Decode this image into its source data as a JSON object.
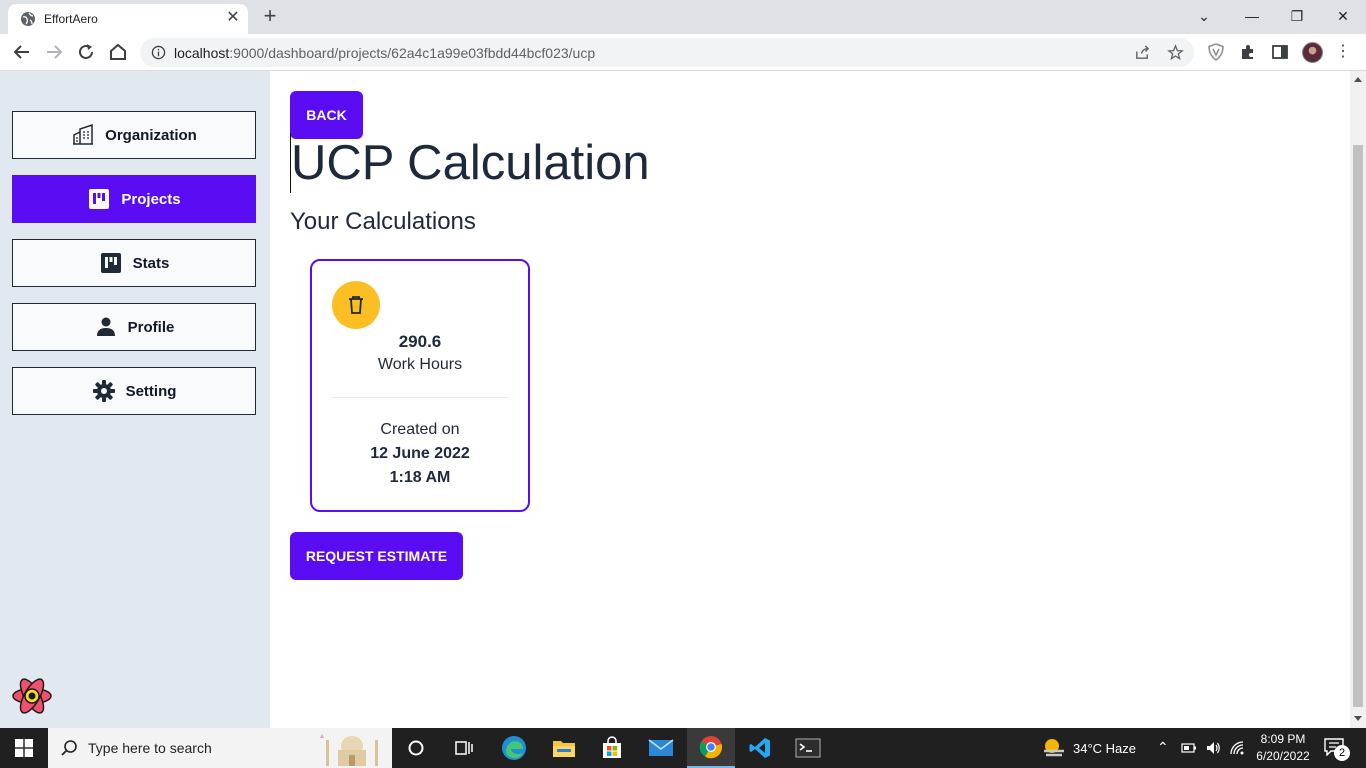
{
  "browser": {
    "tab_title": "EffortAero",
    "url_host": "localhost",
    "url_rest": ":9000/dashboard/projects/62a4c1a99e03fbdd44bcf023/ucp"
  },
  "sidebar": {
    "items": [
      {
        "label": "Organization",
        "icon": "building-icon",
        "active": false
      },
      {
        "label": "Projects",
        "icon": "board-icon",
        "active": true
      },
      {
        "label": "Stats",
        "icon": "board-icon",
        "active": false
      },
      {
        "label": "Profile",
        "icon": "person-icon",
        "active": false
      },
      {
        "label": "Setting",
        "icon": "gear-icon",
        "active": false
      }
    ]
  },
  "main": {
    "back_label": "BACK",
    "title": "UCP Calculation",
    "section_title": "Your Calculations",
    "card": {
      "hours_value": "290.6",
      "hours_label": "Work Hours",
      "created_label": "Created on",
      "created_date": "12 June 2022",
      "created_time": "1:18 AM"
    },
    "request_label": "REQUEST ESTIMATE"
  },
  "taskbar": {
    "search_placeholder": "Type here to search",
    "weather": "34°C  Haze",
    "time": "8:09 PM",
    "date": "6/20/2022",
    "notification_count": "2"
  },
  "colors": {
    "accent": "#5a0df2",
    "sidebar_bg": "#e2e8f0",
    "trash_bg": "#fbbf24"
  }
}
